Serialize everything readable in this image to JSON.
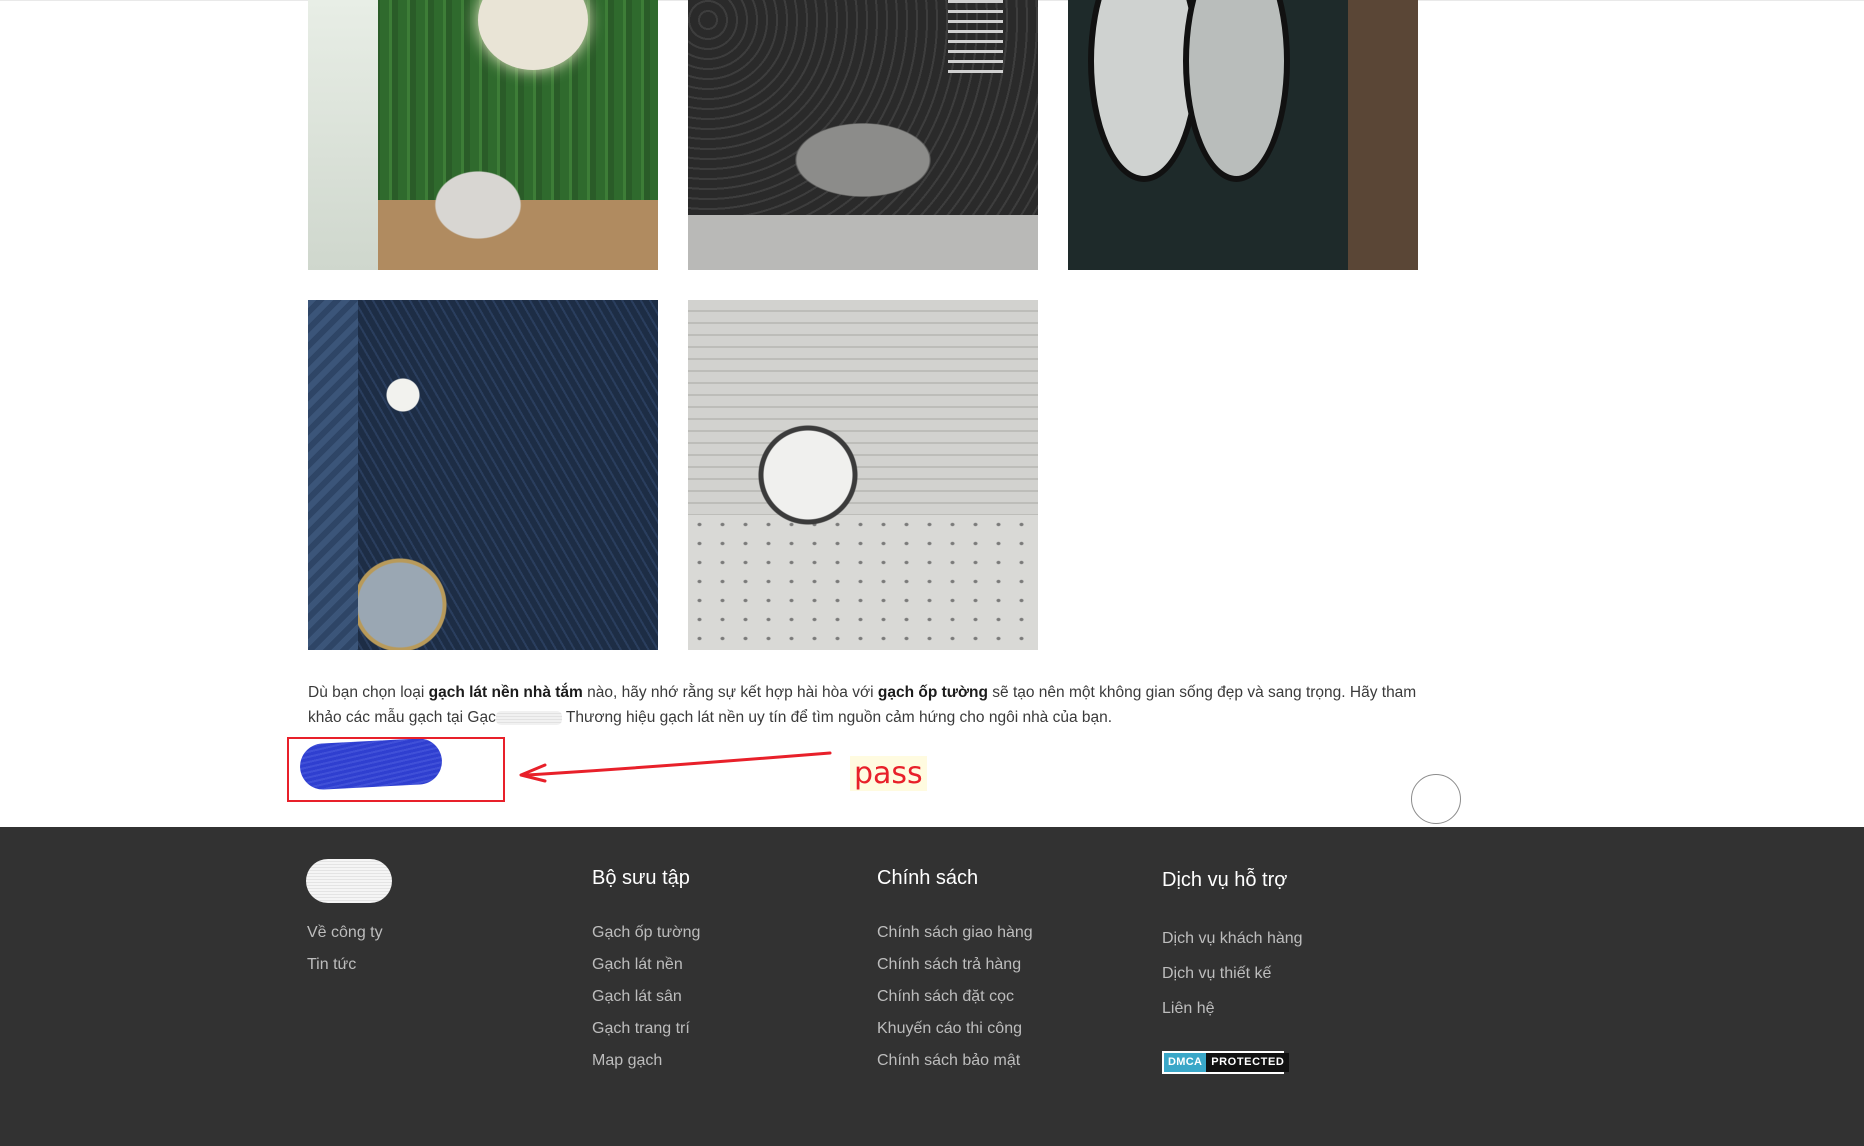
{
  "gallery": {
    "images": [
      {
        "subject": "green tile bathroom vanity with round mirror"
      },
      {
        "subject": "dark hexagon tile bathroom with freestanding tub"
      },
      {
        "subject": "dark mosaic bathroom with double round mirrors"
      },
      {
        "subject": "navy hexagon tile wall with pendant lamp"
      },
      {
        "subject": "white linear tile with round mirror and terrazzo counter"
      }
    ]
  },
  "content": {
    "t1": "Dù bạn chọn loại ",
    "b1": "gạch lát nền nhà tắm",
    "t2": " nào, hãy nhớ rằng sự kết hợp hài hòa với ",
    "b2": "gạch ốp tường",
    "t3": " sẽ tạo nên một không gian sống đẹp và sang trọng. Hãy tham khảo các mẫu gạch tại Gạc",
    "t4": " Thương hiệu gạch lát nền uy tín để tìm nguồn cảm hứng cho ngôi nhà của bạn."
  },
  "annotation": {
    "label": "pass",
    "color": "#e8202a",
    "scribble_color": "#3344cc"
  },
  "footer": {
    "about": {
      "links": [
        "Về công ty",
        "Tin tức"
      ]
    },
    "collection": {
      "title": "Bộ sưu tập",
      "links": [
        "Gạch ốp tường",
        "Gạch lát nền",
        "Gạch lát sân",
        "Gạch trang trí",
        "Map gạch"
      ]
    },
    "policy": {
      "title": "Chính sách",
      "links": [
        "Chính sách giao hàng",
        "Chính sách trả hàng",
        "Chính sách đặt cọc",
        "Khuyến cáo thi công",
        "Chính sách bảo mật"
      ]
    },
    "support": {
      "title": "Dịch vụ hỗ trợ",
      "links": [
        "Dịch vụ khách hàng",
        "Dịch vụ thiết kế",
        "Liên hệ"
      ]
    },
    "dmca": {
      "part1": "DMCA",
      "part2": "PROTECTED"
    },
    "background": "#323232"
  }
}
